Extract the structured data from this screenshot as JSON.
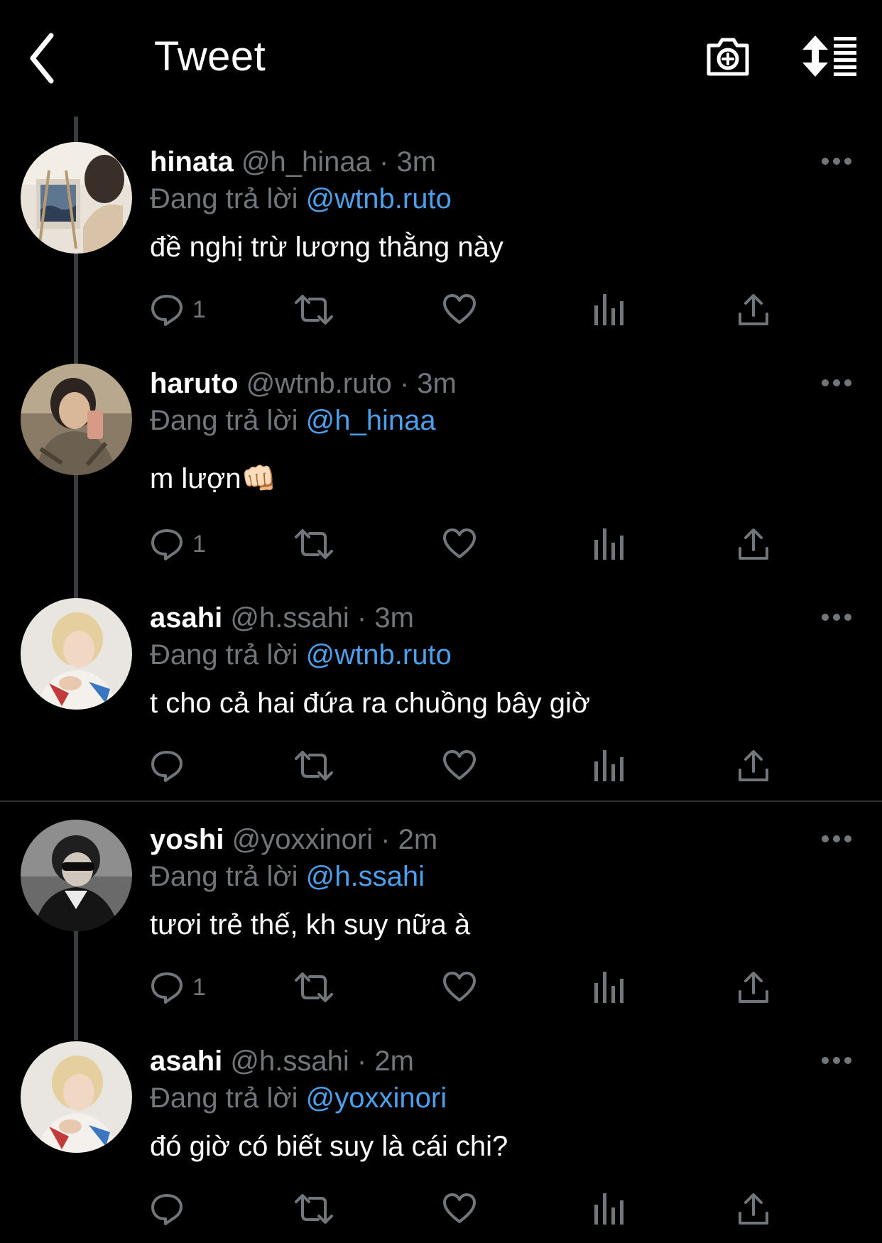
{
  "header": {
    "title": "Tweet",
    "back_icon": "chevron-left-icon",
    "camera_icon": "camera-plus-icon",
    "sort_icon": "sort-list-icon"
  },
  "colors": {
    "background": "#000000",
    "primary_text": "#ffffff",
    "secondary_text": "#71767b",
    "link": "#4c9fea",
    "thread_line": "#3a3d40",
    "divider": "#2f3336"
  },
  "reply_prefix": "Đang trả lời",
  "tweets": [
    {
      "name": "hinata",
      "handle": "@h_hinaa",
      "separator": "·",
      "time": "3m",
      "reply_to": "@wtnb.ruto",
      "text": "đề nghị trừ lương thằng này",
      "reply_count": "1"
    },
    {
      "name": "haruto",
      "handle": "@wtnb.ruto",
      "separator": "·",
      "time": "3m",
      "reply_to": "@h_hinaa",
      "text": "m lượn👊🏻",
      "reply_count": "1"
    },
    {
      "name": "asahi",
      "handle": "@h.ssahi",
      "separator": "·",
      "time": "3m",
      "reply_to": "@wtnb.ruto",
      "text": "t cho cả hai đứa ra chuồng bây giờ",
      "reply_count": ""
    },
    {
      "name": "yoshi",
      "handle": "@yoxxinori",
      "separator": "·",
      "time": "2m",
      "reply_to": "@h.ssahi",
      "text": "tươi trẻ thế, kh suy nữa à",
      "reply_count": "1"
    },
    {
      "name": "asahi",
      "handle": "@h.ssahi",
      "separator": "·",
      "time": "2m",
      "reply_to": "@yoxxinori",
      "text": "đó giờ có biết suy là cái chi?",
      "reply_count": ""
    }
  ]
}
